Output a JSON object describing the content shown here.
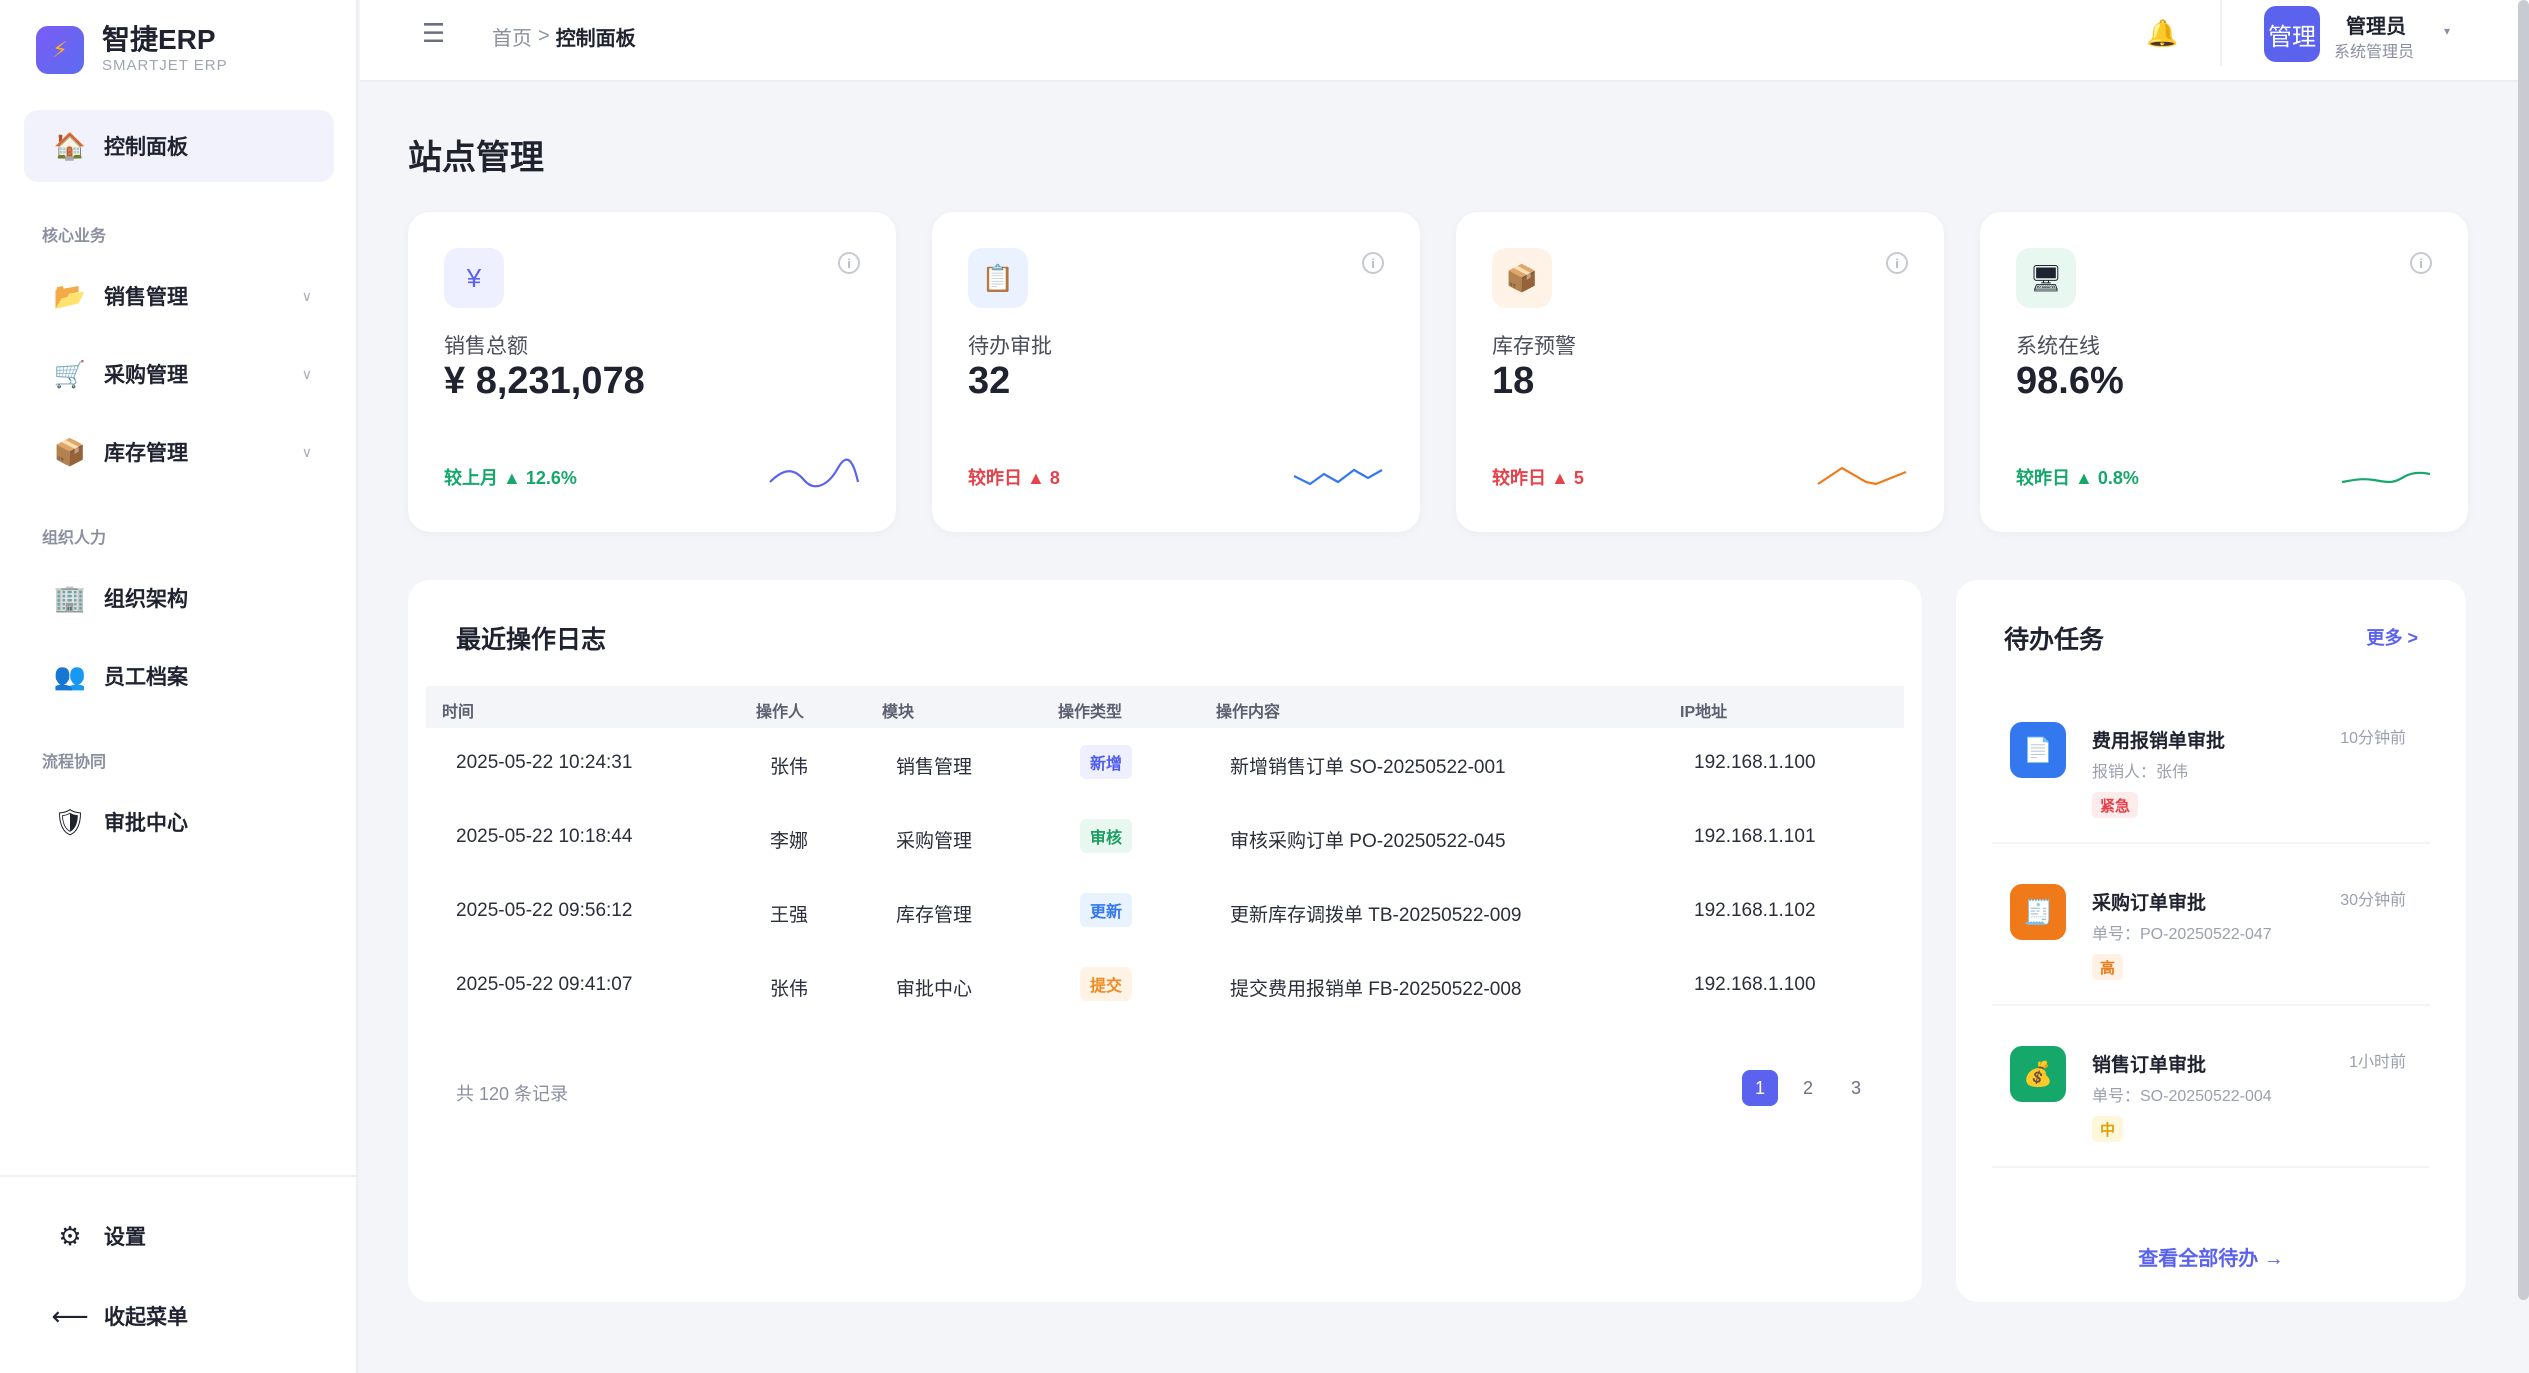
{
  "brand": {
    "name": "智捷ERP",
    "sub": "SMARTJET ERP",
    "logo_icon": "⚡"
  },
  "sidebar": {
    "dashboard": {
      "label": "控制面板",
      "icon": "🏠"
    },
    "groups": [
      "核心业务",
      "组织人力",
      "流程协同"
    ],
    "items": [
      {
        "label": "销售管理",
        "icon": "📂",
        "caret": "∨"
      },
      {
        "label": "采购管理",
        "icon": "🛒",
        "caret": "∨"
      },
      {
        "label": "库存管理",
        "icon": "📦",
        "caret": "∨"
      },
      {
        "label": "组织架构",
        "icon": "🏢"
      },
      {
        "label": "员工档案",
        "icon": "👥"
      },
      {
        "label": "审批中心",
        "icon": "🛡"
      }
    ],
    "settings": {
      "label": "设置",
      "icon": "⚙"
    },
    "collapse": {
      "label": "收起菜单",
      "icon": "⟵"
    }
  },
  "header": {
    "menu_icon": "☰",
    "breadcrumb": {
      "home": "首页",
      "sep": ">",
      "current": "控制面板"
    },
    "bell_icon": "🔔",
    "avatar_text": "管理",
    "user_name": "管理员",
    "user_role": "系统管理员",
    "caret": "▾"
  },
  "page_title": "站点管理",
  "stats": [
    {
      "icon": "¥",
      "label": "销售总额",
      "value": "¥ 8,231,078",
      "trend_label": "较上月",
      "trend_value": "12.6%",
      "trend_arrow": "▲",
      "color": "#16a86a",
      "spark_color": "#5b63ee",
      "info": "i"
    },
    {
      "icon": "📋",
      "label": "待办审批",
      "value": "32",
      "trend_label": "较昨日",
      "trend_value": "8",
      "trend_arrow": "▲",
      "color": "#e5434b",
      "spark_color": "#3478f0",
      "info": "i"
    },
    {
      "icon": "📦",
      "label": "库存预警",
      "value": "18",
      "trend_label": "较昨日",
      "trend_value": "5",
      "trend_arrow": "▲",
      "color": "#e5434b",
      "spark_color": "#f07a1a",
      "info": "i"
    },
    {
      "icon": "🖥",
      "label": "系统在线",
      "value": "98.6%",
      "trend_label": "较昨日",
      "trend_value": "0.8%",
      "trend_arrow": "▲",
      "color": "#16a86a",
      "spark_color": "#16a86a",
      "info": "i"
    }
  ],
  "logs": {
    "title": "最近操作日志",
    "columns": [
      "时间",
      "操作人",
      "模块",
      "操作类型",
      "操作内容",
      "IP地址"
    ],
    "rows": [
      {
        "time": "2025-05-22 10:24:31",
        "user": "张伟",
        "module": "销售管理",
        "type": "新增",
        "content": "新增销售订单 SO-20250522-001",
        "ip": "192.168.1.100"
      },
      {
        "time": "2025-05-22 10:18:44",
        "user": "李娜",
        "module": "采购管理",
        "type": "审核",
        "content": "审核采购订单 PO-20250522-045",
        "ip": "192.168.1.101"
      },
      {
        "time": "2025-05-22 09:56:12",
        "user": "王强",
        "module": "库存管理",
        "type": "更新",
        "content": "更新库存调拨单 TB-20250522-009",
        "ip": "192.168.1.102"
      },
      {
        "time": "2025-05-22 09:41:07",
        "user": "张伟",
        "module": "审批中心",
        "type": "提交",
        "content": "提交费用报销单 FB-20250522-008",
        "ip": "192.168.1.100"
      }
    ],
    "total": "共 120 条记录",
    "pages": [
      "1",
      "2",
      "3"
    ]
  },
  "tasks": {
    "title": "待办任务",
    "more": "更多 >",
    "items": [
      {
        "name": "费用报销单审批",
        "sub": "报销人：张伟",
        "time": "10分钟前",
        "badge": "紧急",
        "icon": "📄",
        "icon_bg": "#3478f0"
      },
      {
        "name": "采购订单审批",
        "sub": "单号：PO-20250522-047",
        "time": "30分钟前",
        "badge": "高",
        "icon": "🧾",
        "icon_bg": "#f07a1a"
      },
      {
        "name": "销售订单审批",
        "sub": "单号：SO-20250522-004",
        "time": "1小时前",
        "badge": "中",
        "icon": "💰",
        "icon_bg": "#16a86a"
      }
    ],
    "view_all": "查看全部待办 →"
  }
}
